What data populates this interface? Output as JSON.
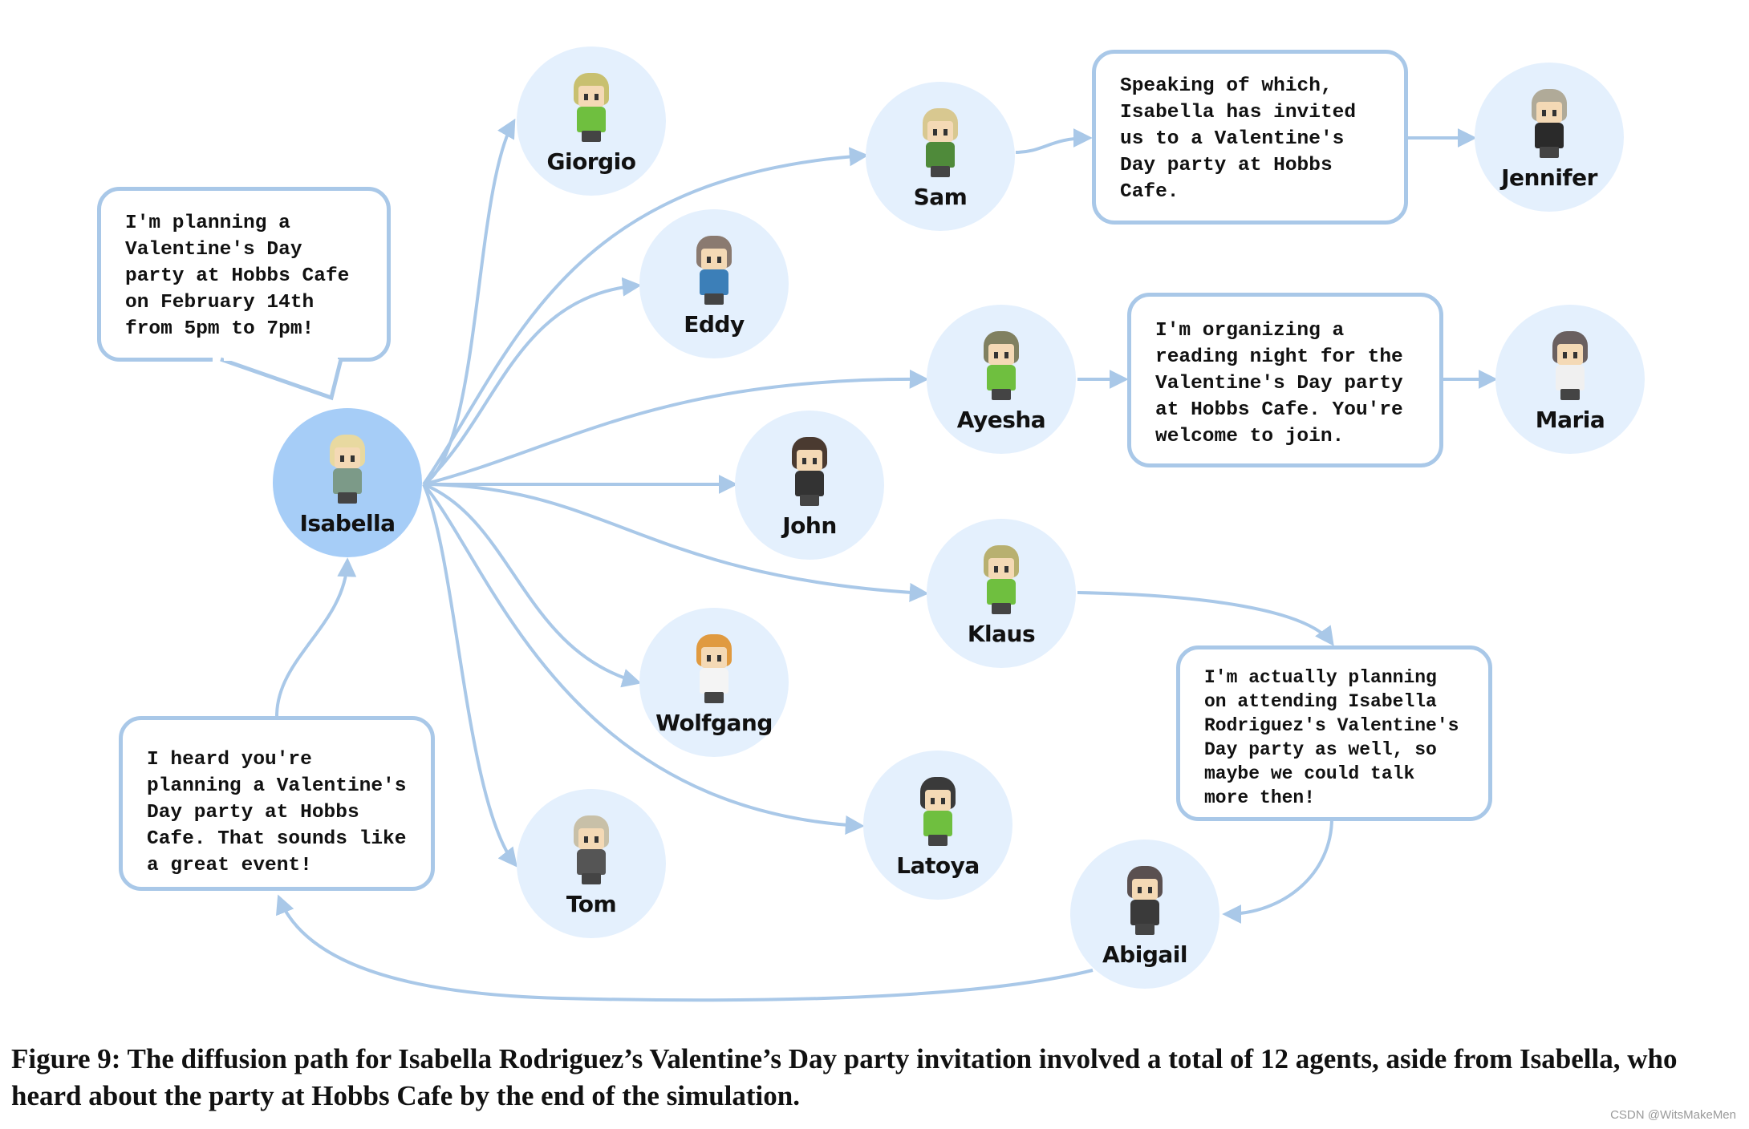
{
  "figure": {
    "caption": "Figure 9: The diffusion path for Isabella Rodriguez’s Valentine’s Day party invitation involved a total of 12 agents, aside from Isabella, who heard about the party at Hobbs Cafe by the end of the simulation.",
    "credit": "CSDN @WitsMakeMen"
  },
  "colors": {
    "edge": "#a9c8e8",
    "root_node": "#a6cdf7",
    "node": "#e4f0fd",
    "bubble_border": "#a9c8e8"
  },
  "nodes": [
    {
      "id": "isabella",
      "name": "Isabella",
      "root": true,
      "hair": "#e8d9a0",
      "outfit": "#7c9a88"
    },
    {
      "id": "giorgio",
      "name": "Giorgio",
      "hair": "#c8c070",
      "outfit": "#6fbf3f"
    },
    {
      "id": "sam",
      "name": "Sam",
      "hair": "#d8c890",
      "outfit": "#4f8a3a"
    },
    {
      "id": "eddy",
      "name": "Eddy",
      "hair": "#8a7a70",
      "outfit": "#3c7fb8"
    },
    {
      "id": "ayesha",
      "name": "Ayesha",
      "hair": "#808060",
      "outfit": "#6fbf3f"
    },
    {
      "id": "john",
      "name": "John",
      "hair": "#4a3a30",
      "outfit": "#333333"
    },
    {
      "id": "klaus",
      "name": "Klaus",
      "hair": "#b8b070",
      "outfit": "#6fbf3f"
    },
    {
      "id": "wolfgang",
      "name": "Wolfgang",
      "hair": "#e09a40",
      "outfit": "#f4f4f4"
    },
    {
      "id": "latoya",
      "name": "Latoya",
      "hair": "#3a3a3a",
      "outfit": "#6fbf3f"
    },
    {
      "id": "tom",
      "name": "Tom",
      "hair": "#c8c0a8",
      "outfit": "#555555"
    },
    {
      "id": "abigail",
      "name": "Abigail",
      "hair": "#5a5050",
      "outfit": "#3a3a3a"
    },
    {
      "id": "jennifer",
      "name": "Jennifer",
      "hair": "#b0aa98",
      "outfit": "#2a2a2a"
    },
    {
      "id": "maria",
      "name": "Maria",
      "hair": "#6a6060",
      "outfit": "#f0f0f0"
    }
  ],
  "bubbles": [
    {
      "id": "isabella-says",
      "speaker": "Isabella",
      "text": "I'm planning a\nValentine's Day\nparty at Hobbs Cafe\non February 14th\nfrom 5pm to 7pm!"
    },
    {
      "id": "sam-says",
      "speaker": "Sam",
      "text": "Speaking of which,\nIsabella has invited\nus to a Valentine's\nDay party at Hobbs\nCafe."
    },
    {
      "id": "ayesha-says",
      "speaker": "Ayesha",
      "text": "I'm organizing a\nreading night for the\nValentine's Day party\nat Hobbs Cafe. You're\nwelcome to join."
    },
    {
      "id": "klaus-says",
      "speaker": "Klaus",
      "text": "I'm actually planning\non attending Isabella\nRodriguez's Valentine's\nDay party as well, so\nmaybe we could talk\nmore then!"
    },
    {
      "id": "abigail-says",
      "speaker": "Abigail",
      "text": "I heard you're\nplanning a Valentine's\nDay party at Hobbs\nCafe. That sounds like\na great event!"
    }
  ],
  "edges": [
    {
      "from": "isabella",
      "to": "giorgio"
    },
    {
      "from": "isabella",
      "to": "sam"
    },
    {
      "from": "isabella",
      "to": "eddy"
    },
    {
      "from": "isabella",
      "to": "ayesha"
    },
    {
      "from": "isabella",
      "to": "john"
    },
    {
      "from": "isabella",
      "to": "klaus"
    },
    {
      "from": "isabella",
      "to": "wolfgang"
    },
    {
      "from": "isabella",
      "to": "latoya"
    },
    {
      "from": "isabella",
      "to": "tom"
    },
    {
      "from": "sam",
      "to": "sam-says"
    },
    {
      "from": "sam-says",
      "to": "jennifer"
    },
    {
      "from": "ayesha",
      "to": "ayesha-says"
    },
    {
      "from": "ayesha-says",
      "to": "maria"
    },
    {
      "from": "klaus",
      "to": "klaus-says"
    },
    {
      "from": "klaus-says",
      "to": "abigail"
    },
    {
      "from": "abigail",
      "to": "abigail-says"
    },
    {
      "from": "abigail-says",
      "to": "isabella"
    }
  ]
}
